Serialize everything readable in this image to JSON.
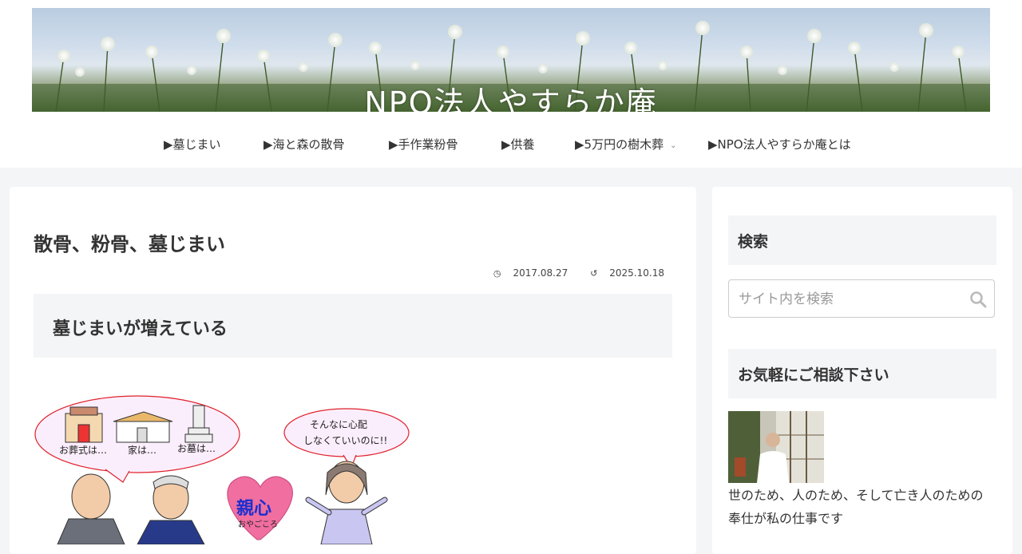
{
  "site": {
    "title": "NPO法人やすらか庵"
  },
  "nav": {
    "items": [
      {
        "label": "▶墓じまい"
      },
      {
        "label": "▶海と森の散骨"
      },
      {
        "label": "▶手作業粉骨"
      },
      {
        "label": "▶供養"
      },
      {
        "label": "▶5万円の樹木葬",
        "has_dropdown": true
      },
      {
        "label": "▶NPO法人やすらか庵とは"
      }
    ]
  },
  "post": {
    "title": "散骨、粉骨、墓じまい",
    "published": "2017.08.27",
    "updated": "2025.10.18",
    "heading": "墓じまいが増えている",
    "illustration": {
      "bubble_items": [
        "お葬式は…",
        "家は…",
        "お墓は…"
      ],
      "bubble_reply_line1": "そんなに心配",
      "bubble_reply_line2": "しなくていいのに!!",
      "heart_text": "親心",
      "heart_reading": "おやごころ"
    }
  },
  "sidebar": {
    "search_title": "検索",
    "search_placeholder": "サイト内を検索",
    "contact_title": "お気軽にご相談下さい",
    "profile_text": "世のため、人のため、そして亡き人のための 奉仕が私の仕事です"
  },
  "colors": {
    "background": "#f4f5f7",
    "card": "#ffffff",
    "heading_box": "#f4f5f7",
    "heart": "#f06ea0",
    "bubble_border": "#e0202a"
  }
}
